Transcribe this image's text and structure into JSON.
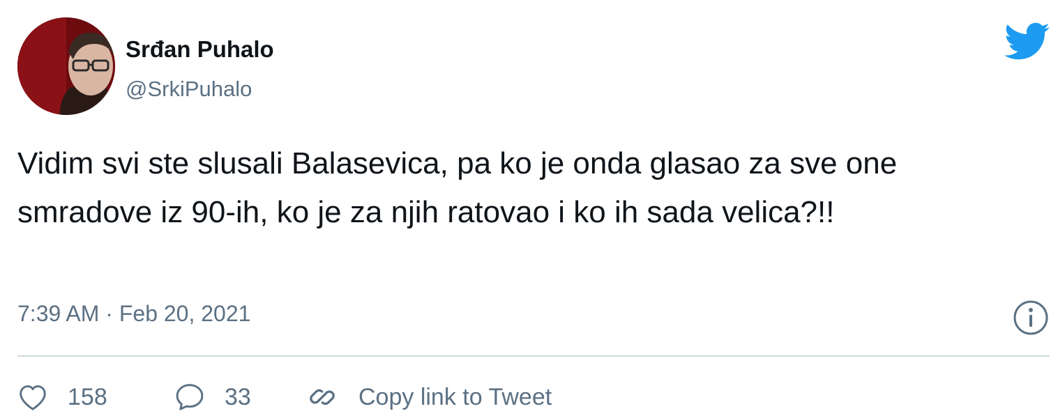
{
  "author": {
    "name": "Srđan Puhalo",
    "handle": "@SrkiPuhalo"
  },
  "tweet": {
    "text": "Vidim svi ste slusali Balasevica, pa ko je onda glasao za sve one smradove iz 90-ih, ko je za njih ratovao i ko ih sada velica?!!",
    "timestamp": "7:39 AM · Feb 20, 2021"
  },
  "actions": {
    "likes": "158",
    "replies": "33",
    "copy_link_label": "Copy link to Tweet"
  },
  "icons": {
    "brand": "twitter-bird-icon",
    "info": "info-icon",
    "like": "heart-icon",
    "reply": "speech-bubble-icon",
    "link": "link-icon"
  },
  "colors": {
    "brand": "#1d9bf0",
    "text": "#0f1419",
    "secondary": "#5b7083",
    "divider": "#cfd9de"
  }
}
